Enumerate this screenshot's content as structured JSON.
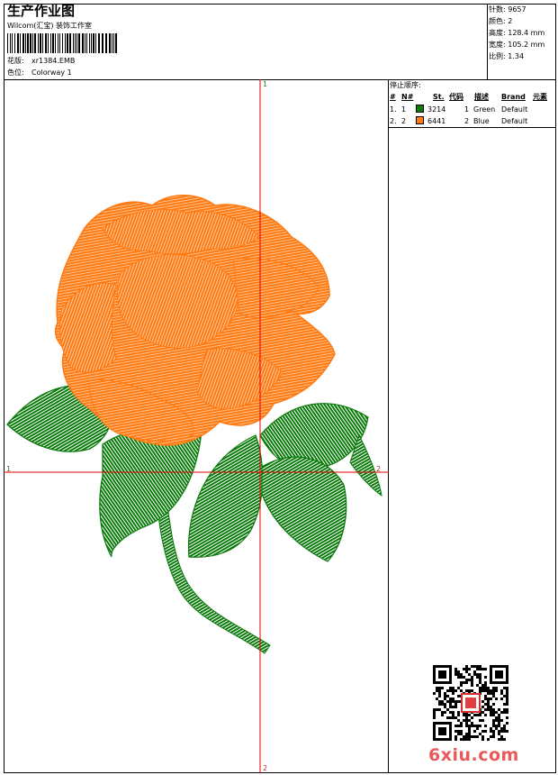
{
  "header": {
    "title": "生产作业图",
    "company": "Wilcom(汇宝) 装饰工作室",
    "design_label": "花版:",
    "design_value": "xr1384.EMB",
    "colorway_label": "色位:",
    "colorway_value": "Colorway 1"
  },
  "stats": {
    "stitches": "针数: 9657",
    "colors": "颜色: 2",
    "height": "高度: 128.4 mm",
    "width": "宽度: 105.2 mm",
    "scale": "比例: 1.34"
  },
  "stop_sequence": {
    "title": "停止顺序:",
    "columns": [
      "#",
      "N#",
      "St.",
      "代码",
      "描述",
      "Brand",
      "元素"
    ],
    "rows": [
      {
        "index": "1.",
        "needle": "1",
        "color": "#0a7a0a",
        "stitches": "3214",
        "code": "1",
        "description": "Green",
        "brand": "Default"
      },
      {
        "index": "2.",
        "needle": "2",
        "color": "#ff7a12",
        "stitches": "6441",
        "code": "2",
        "description": "Blue",
        "brand": "Default"
      }
    ]
  },
  "canvas": {
    "axis_marker_top": "1",
    "axis_marker_left": "1",
    "axis_marker_right": "2",
    "axis_marker_bottom": "2",
    "crosshair_color": "#e00000",
    "thread_green": "#0a7a0a",
    "thread_orange": "#ff7a12"
  },
  "watermark": {
    "text": "6xiu.com",
    "qr_icon": "qr-code-icon"
  }
}
